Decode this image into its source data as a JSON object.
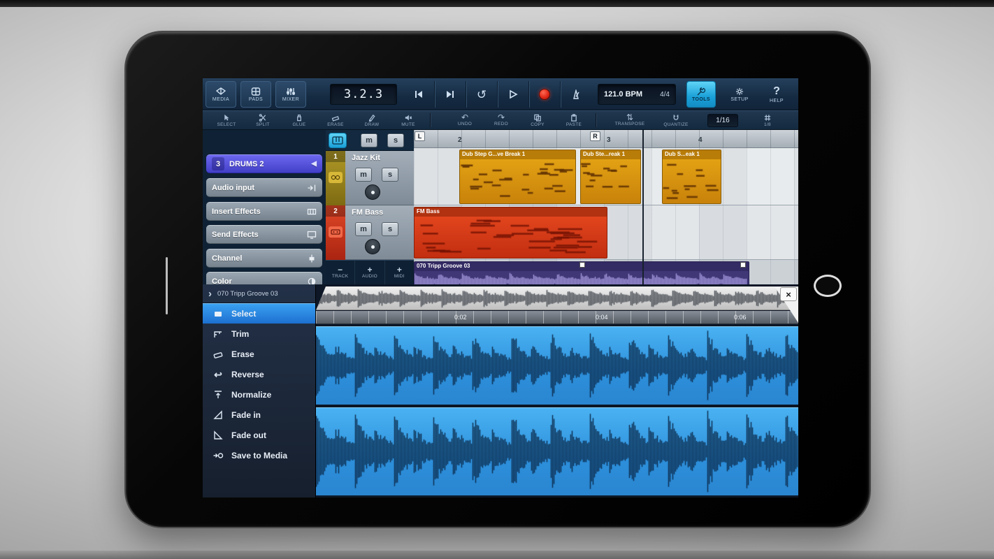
{
  "toolbar": {
    "media": "MEDIA",
    "pads": "PADS",
    "mixer": "MIXER",
    "position": "3.2.3",
    "bpm": "121.0 BPM",
    "timesig": "4/4",
    "tools": "TOOLS",
    "setup": "SETUP",
    "help": "HELP"
  },
  "editbar": {
    "select": "SELECT",
    "split": "SPLIT",
    "glue": "GLUE",
    "erase": "ERASE",
    "draw": "DRAW",
    "mute": "MUTE",
    "undo": "UNDO",
    "redo": "REDO",
    "copy": "COPY",
    "paste": "PASTE",
    "transpose": "TRANSPOSE",
    "quantize": "QUANTIZE",
    "quantize_value": "1/16",
    "grid_value": "1/8"
  },
  "inspector": {
    "selected_track_number": "3",
    "selected_track_name": "DRUMS 2",
    "audio_input": "Audio input",
    "insert_effects": "Insert Effects",
    "send_effects": "Send Effects",
    "channel": "Channel",
    "color": "Color"
  },
  "tracks": {
    "header_mute": "m",
    "header_solo": "s",
    "t1_num": "1",
    "t1_name": "Jazz Kit",
    "t1_mute": "m",
    "t1_solo": "s",
    "t2_num": "2",
    "t2_name": "FM Bass",
    "t2_mute": "m",
    "t2_solo": "s",
    "add_track": "TRACK",
    "add_audio": "AUDIO",
    "add_midi": "MIDI",
    "minus": "−",
    "plus": "+"
  },
  "ruler": {
    "bar2": "2",
    "bar3": "3",
    "bar4": "4",
    "left": "L",
    "right": "R"
  },
  "clips": {
    "midi1": "Dub Step G...ve Break 1",
    "midi2": "Dub Ste...reak 1",
    "midi3": "Dub S...eak 1",
    "bass": "FM Bass",
    "audio": "070 Tripp Groove 03"
  },
  "editor": {
    "title": "070 Tripp Groove 03",
    "menu": {
      "select": "Select",
      "trim": "Trim",
      "erase": "Erase",
      "reverse": "Reverse",
      "normalize": "Normalize",
      "fade_in": "Fade in",
      "fade_out": "Fade out",
      "save": "Save to Media"
    },
    "t1": "0:02",
    "t2": "0:04",
    "t3": "0:06"
  },
  "glyphs": {
    "close": "×",
    "expand": "›",
    "collapse": "◀",
    "undo": "↶",
    "redo": "↷",
    "cycle": "↺",
    "transpose": "⇅",
    "reverse": "↩",
    "help": "?"
  },
  "colors": {
    "tools_cyan": "#2fb4e8",
    "record_red": "#e02818",
    "menu_selected_blue": "#2a86e0",
    "track1_olive": "#9a8418",
    "track2_red": "#d83418",
    "clip_orange": "#d89010",
    "clip_purple": "#453c7e",
    "wave_blue": "#2f97e0"
  }
}
